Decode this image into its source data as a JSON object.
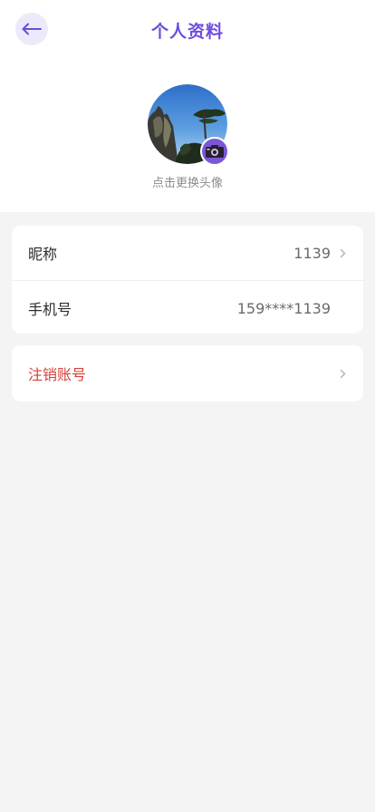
{
  "header": {
    "title": "个人资料",
    "back_icon": "arrow-left-icon",
    "accent_color": "#6c4ce0"
  },
  "profile": {
    "avatar_hint": "点击更换头像",
    "camera_icon": "camera-icon"
  },
  "info": {
    "nickname": {
      "label": "昵称",
      "value": "1139",
      "icon": "chevron-right-icon"
    },
    "phone": {
      "label": "手机号",
      "value": "159****1139"
    }
  },
  "account": {
    "deactivate": {
      "label": "注销账号",
      "icon": "chevron-right-icon",
      "color": "#d6413b"
    }
  }
}
